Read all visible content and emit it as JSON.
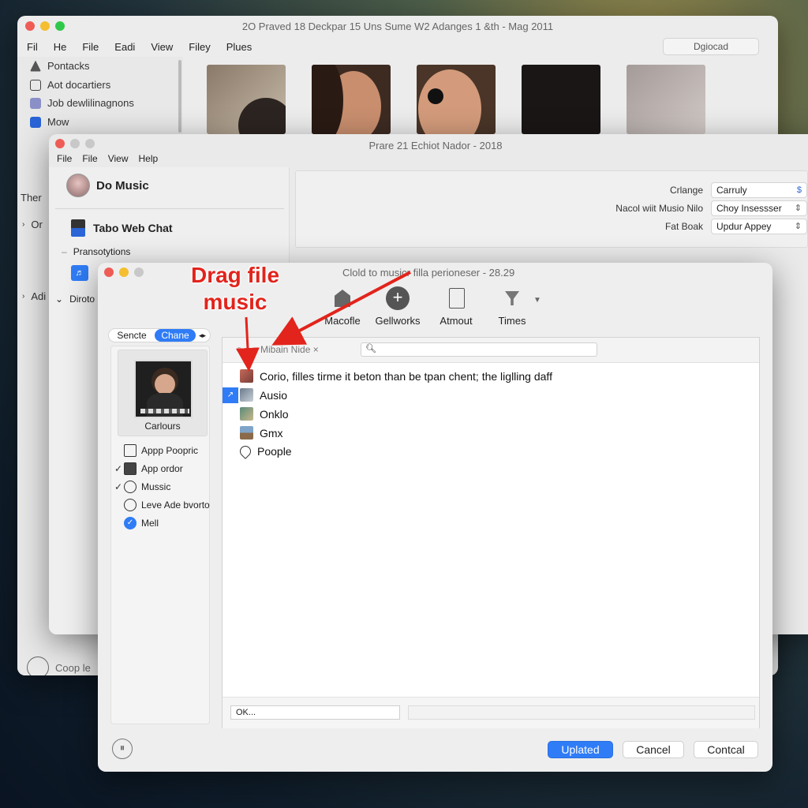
{
  "window1": {
    "title": "2O Praved 18 Deckpar 15 Uns Sume W2 Adanges 1 &th - Mag 2011",
    "menu": [
      "Fil",
      "He",
      "File",
      "Eadi",
      "View",
      "Filey",
      "Plues"
    ],
    "top_button": "Dgiocad",
    "sidebar": [
      "Pontacks",
      "Aot docartiers",
      "Job dewlilinagnons",
      "Mow"
    ],
    "sidebar_partial": [
      "Ther",
      "Or",
      "Adi"
    ],
    "bottom_label": "Coop le"
  },
  "window2": {
    "title": "Prare 21 Echiot Nador - 2018",
    "menu": [
      "File",
      "File",
      "View",
      "Help"
    ],
    "profile_name": "Do Music",
    "web_chat": "Tabo Web Chat",
    "section": "Pransotytions",
    "section2": "Diroto",
    "props": [
      {
        "label": "Crlange",
        "value": "Carruly"
      },
      {
        "label": "Nacol wiit Musio Nilo",
        "value": "Choy Insessser"
      },
      {
        "label": "Fat Boak",
        "value": "Updur Appey"
      }
    ]
  },
  "dialog": {
    "title": "Clold to musicr filla perioneser - 28.29",
    "toolbar": [
      "Macofle",
      "Gellworks",
      "Atmout",
      "Times"
    ],
    "segment": {
      "left": "Sencte",
      "right": "Chane"
    },
    "album_caption": "Carlours",
    "options": [
      {
        "label": "Appp Poopric",
        "checked": false,
        "kind": "box"
      },
      {
        "label": "App ordor",
        "checked": true,
        "kind": "box-filled"
      },
      {
        "label": "Mussic",
        "checked": true,
        "kind": "circle"
      },
      {
        "label": "Leve Ade bvorto",
        "checked": false,
        "kind": "circle"
      },
      {
        "label": "Mell",
        "checked": false,
        "kind": "circle-blue"
      }
    ],
    "search_tag": "Mibain Nide ×",
    "search_placeholder": "",
    "rows": [
      "Corio, filles tirme it beton than be tpan chent; the liglling daff",
      "Ausio",
      "Onklo",
      "Gmx",
      "Poople"
    ],
    "bottom_input": "OK...",
    "buttons": {
      "primary": "Uplated",
      "cancel": "Cancel",
      "third": "Contcal"
    }
  },
  "annotation": {
    "text": "Drag file music",
    "color": "#e2241c"
  }
}
